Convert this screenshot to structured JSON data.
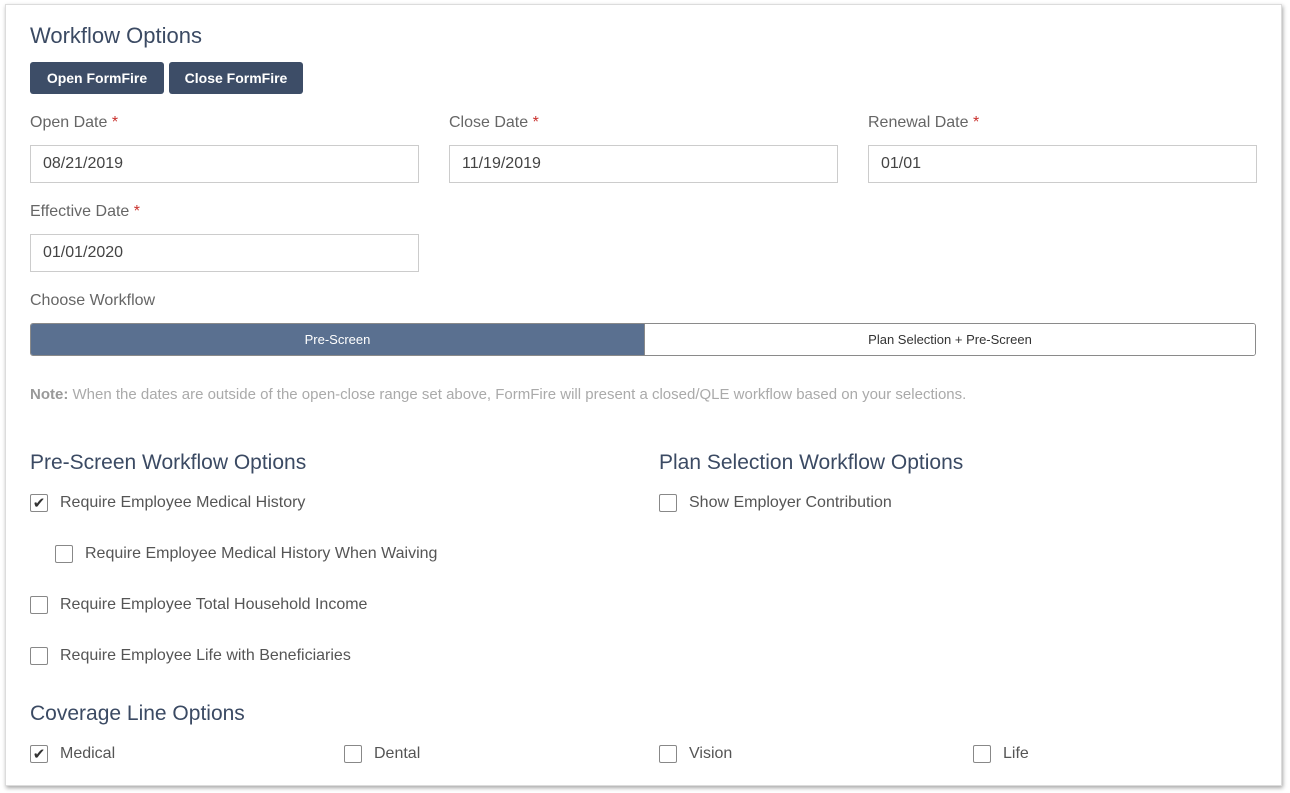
{
  "workflow": {
    "title": "Workflow Options",
    "open_button": "Open FormFire",
    "close_button": "Close FormFire"
  },
  "dates": {
    "required_marker": "*",
    "open": {
      "label": "Open Date",
      "value": "08/21/2019"
    },
    "close": {
      "label": "Close Date",
      "value": "11/19/2019"
    },
    "renewal": {
      "label": "Renewal Date",
      "value": "01/01"
    },
    "effective": {
      "label": "Effective Date",
      "value": "01/01/2020"
    }
  },
  "choose_workflow": {
    "label": "Choose Workflow",
    "options": [
      {
        "label": "Pre-Screen",
        "selected": true
      },
      {
        "label": "Plan Selection + Pre-Screen",
        "selected": false
      }
    ]
  },
  "note": {
    "prefix": "Note:",
    "text": " When the dates are outside of the open-close range set above, FormFire will present a closed/QLE workflow based on your selections."
  },
  "prescreen": {
    "title": "Pre-Screen Workflow Options",
    "items": [
      {
        "label": "Require Employee Medical History",
        "checked": true
      },
      {
        "label": "Require Employee Medical History When Waiving",
        "checked": false
      },
      {
        "label": "Require Employee Total Household Income",
        "checked": false
      },
      {
        "label": "Require Employee Life with Beneficiaries",
        "checked": false
      }
    ]
  },
  "plan_selection": {
    "title": "Plan Selection Workflow Options",
    "items": [
      {
        "label": "Show Employer Contribution",
        "checked": false
      }
    ]
  },
  "coverage": {
    "title": "Coverage Line Options",
    "items": [
      {
        "label": "Medical",
        "checked": true
      },
      {
        "label": "Dental",
        "checked": false
      },
      {
        "label": "Vision",
        "checked": false
      },
      {
        "label": "Life",
        "checked": false
      }
    ]
  },
  "check_glyph": "✔",
  "colors": {
    "primary": "#3d4d67",
    "segment_active": "#5a7090",
    "required": "#c9302c"
  }
}
